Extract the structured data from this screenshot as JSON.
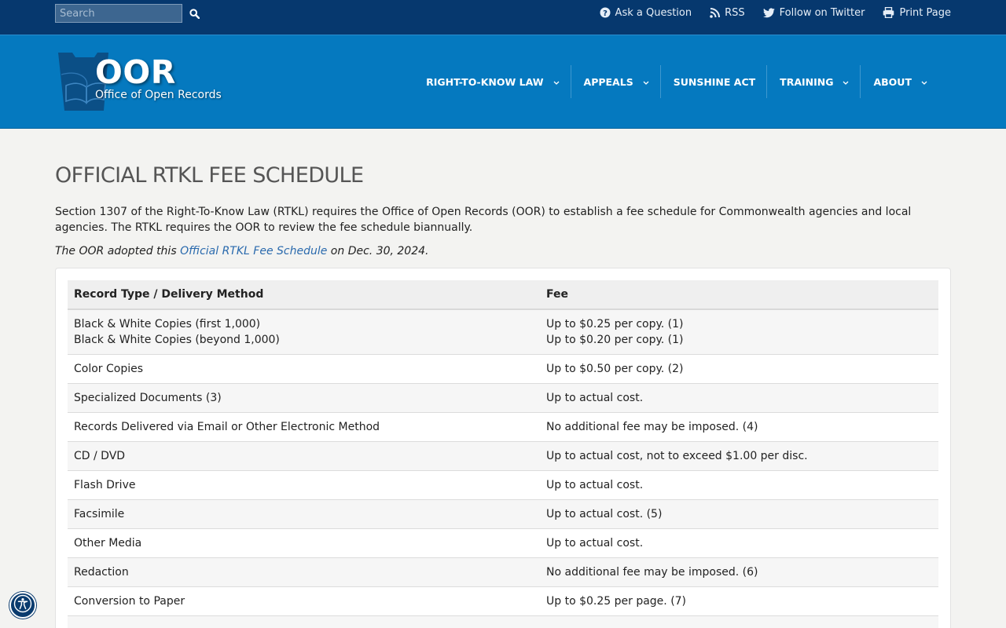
{
  "topbar": {
    "search_placeholder": "Search",
    "links": [
      {
        "label": "Ask a Question",
        "icon": "question-circle-icon"
      },
      {
        "label": "RSS",
        "icon": "rss-icon"
      },
      {
        "label": "Follow on Twitter",
        "icon": "twitter-icon"
      },
      {
        "label": "Print Page",
        "icon": "print-icon"
      }
    ]
  },
  "header": {
    "logo_title": "OOR",
    "logo_subtitle": "Office of Open Records",
    "nav": [
      {
        "label": "RIGHT-TO-KNOW LAW",
        "has_dropdown": true
      },
      {
        "label": "APPEALS",
        "has_dropdown": true
      },
      {
        "label": "SUNSHINE ACT",
        "has_dropdown": false
      },
      {
        "label": "TRAINING",
        "has_dropdown": true
      },
      {
        "label": "ABOUT",
        "has_dropdown": true
      }
    ]
  },
  "main": {
    "title": "OFFICIAL RTKL FEE SCHEDULE",
    "intro": "Section 1307 of the Right-To-Know Law (RTKL) requires the Office of Open Records (OOR) to establish a fee schedule for Commonwealth agencies and local agencies. The RTKL requires the OOR to review the fee schedule biannually.",
    "adopted_prefix": "The OOR adopted this ",
    "adopted_link": "Official RTKL Fee Schedule",
    "adopted_suffix": " on Dec. 30, 2024.",
    "table": {
      "headers": [
        "Record Type / Delivery Method",
        "Fee"
      ],
      "rows": [
        {
          "type": [
            "Black & White Copies (first 1,000)",
            "Black & White Copies (beyond 1,000)"
          ],
          "fee": [
            "Up to $0.25 per copy. (1)",
            "Up to $0.20 per copy. (1)"
          ]
        },
        {
          "type": [
            "Color Copies"
          ],
          "fee": [
            "Up to $0.50 per copy. (2)"
          ]
        },
        {
          "type": [
            "Specialized Documents (3)"
          ],
          "fee": [
            "Up to actual cost."
          ]
        },
        {
          "type": [
            "Records Delivered via Email or Other Electronic Method"
          ],
          "fee": [
            "No additional fee may be imposed. (4)"
          ]
        },
        {
          "type": [
            "CD / DVD"
          ],
          "fee": [
            "Up to actual cost, not to exceed $1.00 per disc."
          ]
        },
        {
          "type": [
            "Flash Drive"
          ],
          "fee": [
            "Up to actual cost."
          ]
        },
        {
          "type": [
            "Facsimile"
          ],
          "fee": [
            "Up to actual cost. (5)"
          ]
        },
        {
          "type": [
            "Other Media"
          ],
          "fee": [
            "Up to actual cost."
          ]
        },
        {
          "type": [
            "Redaction"
          ],
          "fee": [
            "No additional fee may be imposed. (6)"
          ]
        },
        {
          "type": [
            "Conversion to Paper"
          ],
          "fee": [
            "Up to $0.25 per page. (7)"
          ]
        },
        {
          "type": [
            ""
          ],
          "fee": [
            ""
          ]
        }
      ]
    }
  },
  "accessibility_button": {
    "icon": "accessibility-icon"
  },
  "colors": {
    "topbar": "#06386e",
    "header": "#0579bf",
    "link": "#2a6aad",
    "page_bg": "#f3f3f1"
  }
}
